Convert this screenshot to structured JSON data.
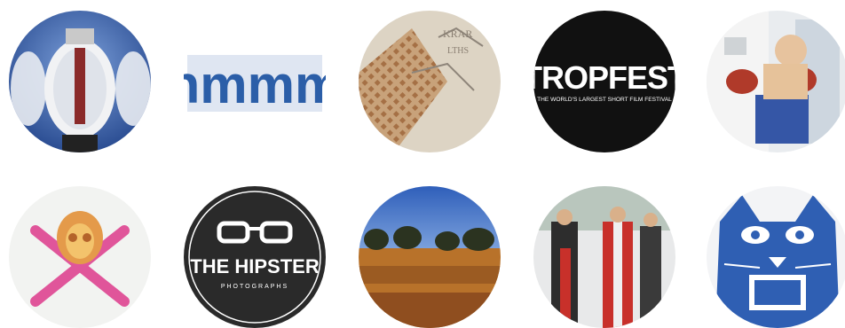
{
  "tiles": [
    {
      "id": "lightbulb",
      "label": ""
    },
    {
      "id": "hmmm",
      "label": "hmmm"
    },
    {
      "id": "map-pattern",
      "label": ""
    },
    {
      "id": "tropfest",
      "title": "TROPFEST",
      "subtitle": "THE WORLD'S LARGEST SHORT FILM FESTIVAL"
    },
    {
      "id": "boxer",
      "label": ""
    },
    {
      "id": "pink-skull",
      "label": ""
    },
    {
      "id": "hipster",
      "title": "THE HIPSTER",
      "subtitle": "PHOTOGRAPHS"
    },
    {
      "id": "landscape",
      "label": ""
    },
    {
      "id": "fashion-figures",
      "label": ""
    },
    {
      "id": "blue-cat",
      "label": ""
    }
  ],
  "colors": {
    "background": "#ffffff",
    "tropfest_bg": "#111111",
    "hipster_bg": "#2a2a2a",
    "hmmm_blue": "#2b5ea8",
    "sky_blue": "#3d6fc4",
    "pink": "#e0559a",
    "red": "#c8302a",
    "cat_blue": "#2f5fb3"
  }
}
